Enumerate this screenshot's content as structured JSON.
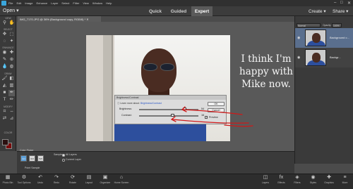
{
  "menubar": {
    "items": [
      "File",
      "Edit",
      "Image",
      "Enhance",
      "Layer",
      "Select",
      "Filter",
      "View",
      "Window",
      "Help"
    ],
    "window_controls": [
      "–",
      "□",
      "✕"
    ]
  },
  "modebar": {
    "open_label": "Open ▾",
    "tabs": [
      "Quick",
      "Guided",
      "Expert"
    ],
    "active_tab": "Expert",
    "create_label": "Create ▾",
    "share_label": "Share ▾"
  },
  "document": {
    "tab_title": "IMG_7170.JPG @ 36% (Background copy, RGB/8) * ✕"
  },
  "toolbox": {
    "sections": [
      "VIEW",
      "SELECT",
      "ENHANCE",
      "DRAW",
      "MODIFY",
      "COLOR"
    ]
  },
  "caption": {
    "line1": "I think I'm",
    "line2": "happy with",
    "line3": "Mike now."
  },
  "dialog": {
    "title": "Brightness/Contrast",
    "learn_prefix": "Learn more about:",
    "learn_link": "Brightness/Contrast",
    "brightness_label": "Brightness:",
    "brightness_value": "54",
    "contrast_label": "Contrast:",
    "contrast_value": "16",
    "brightness_fraction": 0.77,
    "contrast_fraction": 0.57,
    "ok_label": "OK",
    "cancel_label": "Cancel",
    "preview_label": "Preview",
    "preview_checked": "✓"
  },
  "layers_panel": {
    "blend_mode": "Normal",
    "opacity_label": "Opacity:",
    "opacity_value": "100%",
    "layers": [
      {
        "name": "Background c..."
      },
      {
        "name": "Backgr..."
      }
    ]
  },
  "tool_options": {
    "panel_label": "Color Picker",
    "sample_boxes": [
      "1x1",
      "3x3",
      "5x5"
    ],
    "point_sample_label": "Point Sample",
    "sample_label": "Sample:",
    "radio_all": "All Layers",
    "radio_current": "Current Layer"
  },
  "taskbar": {
    "left": [
      {
        "label": "Photo Bin",
        "icon": "photo-bin-icon",
        "glyph": "▦"
      },
      {
        "label": "Tool Options",
        "icon": "tool-options-icon",
        "glyph": "⚙"
      },
      {
        "label": "Undo",
        "icon": "undo-icon",
        "glyph": "↶"
      },
      {
        "label": "Redo",
        "icon": "redo-icon",
        "glyph": "↷"
      },
      {
        "label": "Rotate",
        "icon": "rotate-icon",
        "glyph": "⟳"
      },
      {
        "label": "Layout",
        "icon": "layout-icon",
        "glyph": "▤"
      },
      {
        "label": "Organizer",
        "icon": "organizer-icon",
        "glyph": "▣"
      },
      {
        "label": "Home Screen",
        "icon": "home-icon",
        "glyph": "⌂"
      }
    ],
    "right": [
      {
        "label": "Layers",
        "icon": "layers-icon",
        "glyph": "◫"
      },
      {
        "label": "Effects",
        "icon": "effects-icon",
        "glyph": "fx"
      },
      {
        "label": "Filters",
        "icon": "filters-icon",
        "glyph": "◈"
      },
      {
        "label": "Styles",
        "icon": "styles-icon",
        "glyph": "◉"
      },
      {
        "label": "Graphics",
        "icon": "graphics-icon",
        "glyph": "✚"
      },
      {
        "label": "More",
        "icon": "more-icon",
        "glyph": "≡"
      }
    ]
  },
  "colors": {
    "panel": "#3a3a3a",
    "canvas_bg": "#595959",
    "accent": "#5da0d8",
    "annotation": "#d01818",
    "foreground_color": "#2a1010",
    "background_color": "#7a0c0c"
  }
}
